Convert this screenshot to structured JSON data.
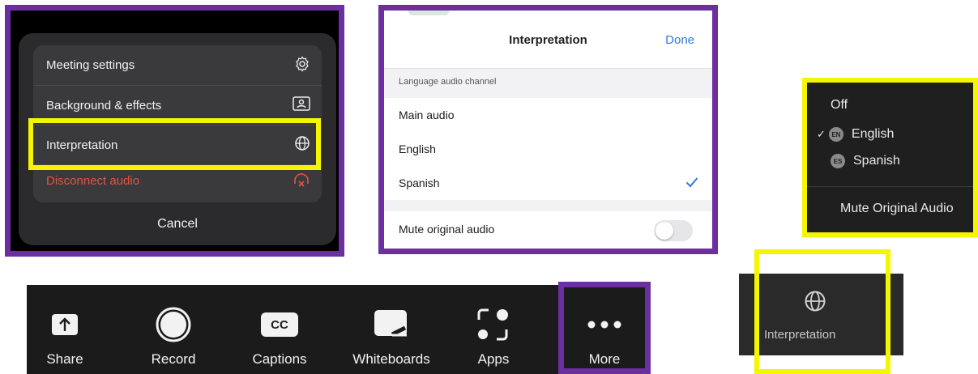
{
  "colors": {
    "purple_border": "#6b2fa0",
    "yellow_highlight": "#f5f500",
    "ios_blue": "#2f7ad9",
    "danger_red": "#e5533f"
  },
  "action_sheet": {
    "items": [
      {
        "label": "Meeting settings",
        "icon": "gear-icon"
      },
      {
        "label": "Background & effects",
        "icon": "background-icon"
      },
      {
        "label": "Interpretation",
        "icon": "globe-icon"
      },
      {
        "label": "Disconnect audio",
        "icon": "headset-x-icon"
      }
    ],
    "cancel_label": "Cancel"
  },
  "interpretation_sheet": {
    "title": "Interpretation",
    "done_label": "Done",
    "section_label": "Language audio channel",
    "options": [
      {
        "label": "Main audio",
        "selected": false
      },
      {
        "label": "English",
        "selected": false
      },
      {
        "label": "Spanish",
        "selected": true
      }
    ],
    "mute_label": "Mute original audio",
    "mute_on": false
  },
  "language_menu": {
    "items": [
      {
        "label": "Off",
        "checked": false,
        "badge": ""
      },
      {
        "label": "English",
        "checked": true,
        "badge": "EN"
      },
      {
        "label": "Spanish",
        "checked": false,
        "badge": "ES"
      }
    ],
    "mute_label": "Mute Original Audio"
  },
  "toolbar": {
    "items": [
      {
        "label": "Share",
        "icon": "share-arrow-icon"
      },
      {
        "label": "Record",
        "icon": "record-icon"
      },
      {
        "label": "Captions",
        "icon": "cc-icon"
      },
      {
        "label": "Whiteboards",
        "icon": "whiteboard-icon"
      },
      {
        "label": "Apps",
        "icon": "apps-icon"
      },
      {
        "label": "More",
        "icon": "ellipsis-icon"
      }
    ],
    "cc_text": "CC"
  },
  "interpretation_button": {
    "label": "Interpretation",
    "icon": "globe-icon"
  }
}
